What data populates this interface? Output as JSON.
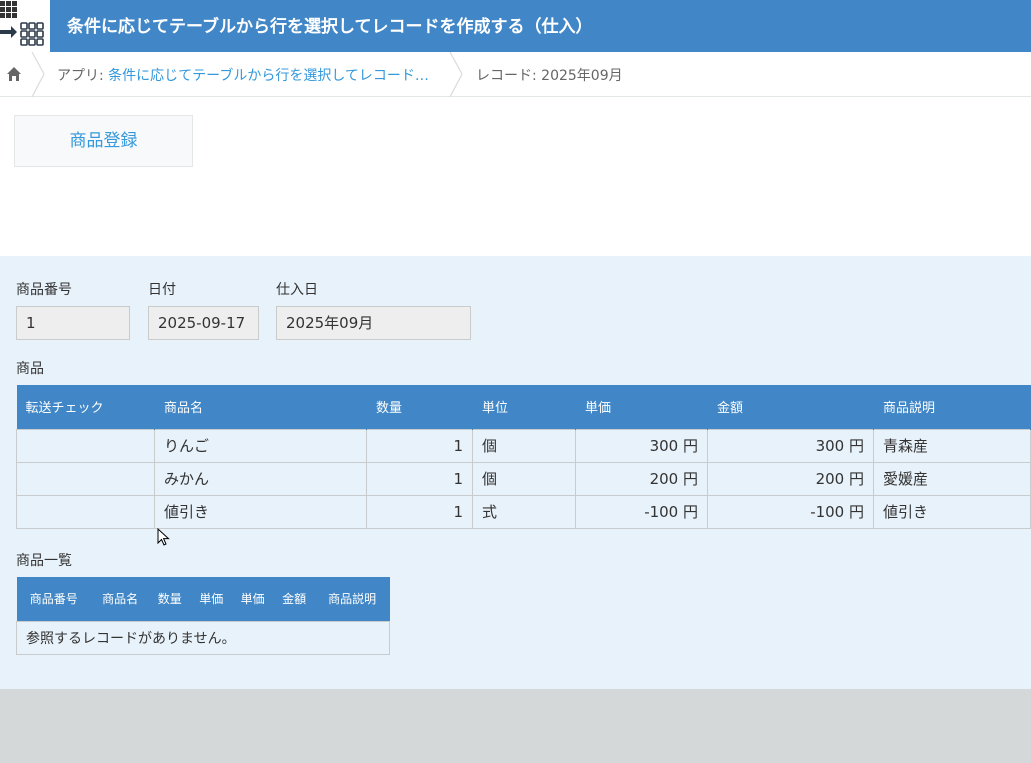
{
  "header": {
    "title": "条件に応じてテーブルから行を選択してレコードを作成する（仕入）"
  },
  "breadcrumb": {
    "app_prefix": "アプリ: ",
    "app_name": "条件に応じてテーブルから行を選択してレコード…",
    "record": "レコード: 2025年09月"
  },
  "toolbar": {
    "register_button": "商品登録"
  },
  "fields": {
    "product_number": {
      "label": "商品番号",
      "value": "1"
    },
    "date": {
      "label": "日付",
      "value": "2025-09-17"
    },
    "purchase_date": {
      "label": "仕入日",
      "value": "2025年09月"
    }
  },
  "product_table": {
    "label": "商品",
    "headers": [
      "転送チェック",
      "商品名",
      "数量",
      "単位",
      "単価",
      "金額",
      "商品説明"
    ],
    "rows": [
      [
        "",
        "りんご",
        "1",
        "個",
        "300 円",
        "300 円",
        "青森産"
      ],
      [
        "",
        "みかん",
        "1",
        "個",
        "200 円",
        "200 円",
        "愛媛産"
      ],
      [
        "",
        "値引き",
        "1",
        "式",
        "-100 円",
        "-100 円",
        "値引き"
      ]
    ]
  },
  "product_list": {
    "label": "商品一覧",
    "headers": [
      "商品番号",
      "商品名",
      "数量",
      "単価",
      "単価",
      "金額",
      "商品説明"
    ],
    "empty_message": "参照するレコードがありません。"
  },
  "icons": {
    "home": "home-icon",
    "app": "app-table-icon",
    "cursor": "mouse-cursor-icon"
  },
  "colors": {
    "header": "#4187c7",
    "form_bg": "#e8f2fa",
    "link": "#3498db"
  }
}
